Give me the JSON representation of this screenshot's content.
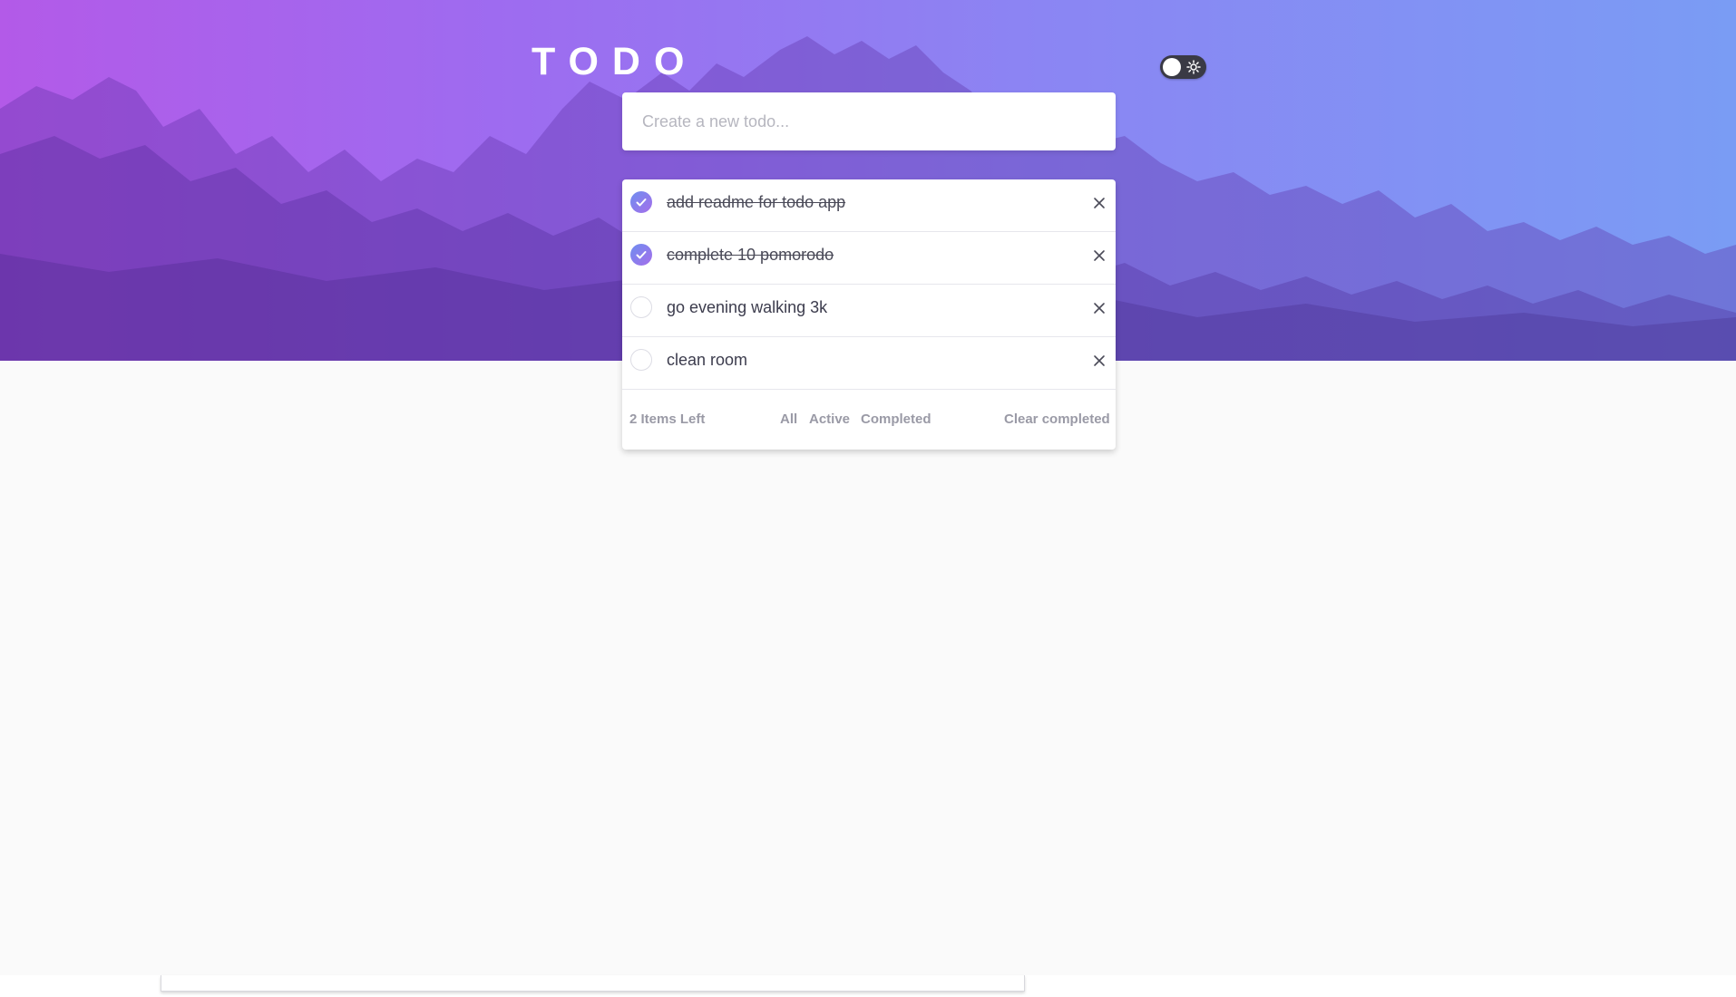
{
  "app": {
    "title": "TODO",
    "theme_toggle_icon": "sun-icon"
  },
  "new_todo": {
    "placeholder": "Create a new todo..."
  },
  "todos": [
    {
      "text": "add readme for todo app",
      "completed": true
    },
    {
      "text": "complete 10 pomorodo",
      "completed": true
    },
    {
      "text": "go evening walking 3k",
      "completed": false
    },
    {
      "text": "clean room",
      "completed": false
    }
  ],
  "footer": {
    "items_left": "2 Items Left",
    "filters": [
      "All",
      "Active",
      "Completed"
    ],
    "clear_completed": "Clear completed"
  },
  "colors": {
    "gradient_start": "#b35ae8",
    "gradient_end": "#7a9cf4",
    "check_gradient_start": "#6f8ef0",
    "check_gradient_end": "#a56eea",
    "page_background": "#fafafa",
    "footer_text": "#9a9aa6"
  }
}
